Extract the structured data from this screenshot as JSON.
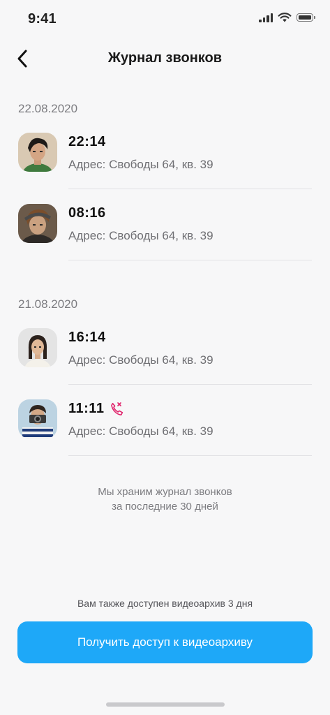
{
  "status_bar": {
    "time": "9:41",
    "icons": [
      "signal-icon",
      "wifi-icon",
      "battery-icon"
    ]
  },
  "header": {
    "back_icon": "chevron-left-icon",
    "title": "Журнал звонков"
  },
  "sections": [
    {
      "date": "22.08.2020",
      "calls": [
        {
          "time": "22:14",
          "address": "Адрес: Свободы 64, кв. 39",
          "missed": false
        },
        {
          "time": "08:16",
          "address": "Адрес: Свободы 64, кв. 39",
          "missed": false
        }
      ]
    },
    {
      "date": "21.08.2020",
      "calls": [
        {
          "time": "16:14",
          "address": "Адрес: Свободы 64, кв. 39",
          "missed": false
        },
        {
          "time": "11:11",
          "address": "Адрес: Свободы 64, кв. 39",
          "missed": true
        }
      ]
    }
  ],
  "info": {
    "line1": "Мы храним журнал звонков",
    "line2": "за последние 30 дней"
  },
  "archive": {
    "note": "Вам также доступен видеоархив 3 дня",
    "button_label": "Получить доступ к видеоархиву"
  },
  "colors": {
    "accent": "#1ea8f8",
    "missed_call": "#e0246c",
    "background": "#f7f7f8"
  }
}
